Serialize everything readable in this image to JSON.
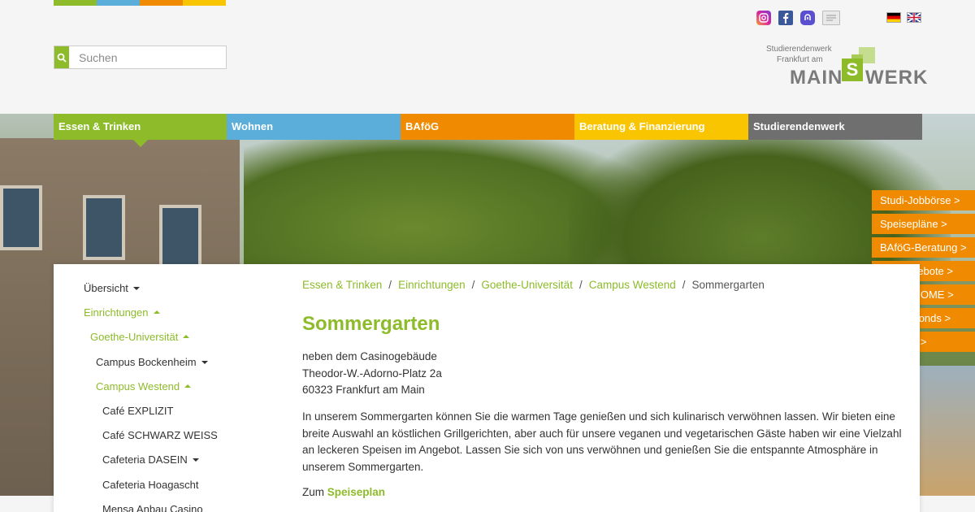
{
  "brand_colors": {
    "green": "#8dbb2a",
    "blue": "#5aaed9",
    "orange": "#f08a00",
    "yellow": "#f9c400",
    "gray": "#6f6f6f"
  },
  "search": {
    "placeholder": "Suchen"
  },
  "social": [
    "instagram-icon",
    "facebook-icon",
    "mastodon-icon",
    "blog-icon"
  ],
  "languages": [
    "german-flag-icon",
    "english-flag-icon"
  ],
  "logo": {
    "line1": "Studierendenwerk",
    "line2": "Frankfurt am",
    "main": "MAIN",
    "s": "S",
    "werk": "WERK"
  },
  "nav": [
    {
      "label": "Essen & Trinken",
      "color": "#8dbb2a",
      "active": true
    },
    {
      "label": "Wohnen",
      "color": "#5aaed9"
    },
    {
      "label": "BAföG",
      "color": "#f08a00"
    },
    {
      "label": "Beratung & Finanzierung",
      "color": "#f9c400"
    },
    {
      "label": "Studierendenwerk",
      "color": "#6f6f6f"
    }
  ],
  "quick_links": [
    "Studi-Jobbörse >",
    "Speisepläne >",
    "BAföG-Beratung >",
    "Mietangebote >",
    "Hostel HOME >",
    "Nothilfefonds >",
    "Karriere >"
  ],
  "sidenav": [
    {
      "label": "Übersicht",
      "caret": "down"
    },
    {
      "label": "Einrichtungen",
      "caret": "up",
      "active": true
    },
    {
      "label": "Goethe-Universität",
      "caret": "up",
      "active": true
    },
    {
      "label": "Campus Bockenheim",
      "caret": "down"
    },
    {
      "label": "Campus Westend",
      "caret": "up",
      "active": true
    },
    {
      "label": "Café EXPLIZIT"
    },
    {
      "label": "Café SCHWARZ WEISS"
    },
    {
      "label": "Cafeteria DASEIN",
      "caret": "down"
    },
    {
      "label": "Cafeteria Hoagascht"
    },
    {
      "label": "Mensa Anbau Casino"
    }
  ],
  "breadcrumb": [
    "Essen & Trinken",
    "Einrichtungen",
    "Goethe-Universität",
    "Campus Westend",
    "Sommergarten"
  ],
  "page": {
    "title": "Sommergarten",
    "address": [
      "neben dem Casinogebäude",
      "Theodor-W.-Adorno-Platz 2a",
      "60323 Frankfurt am Main"
    ],
    "intro": "In unserem Sommergarten können Sie die warmen Tage genießen und sich kulinarisch verwöhnen lassen. Wir bieten eine breite Auswahl an köstlichen Grillgerichten, aber auch für unsere veganen und vegetarischen Gäste haben wir eine Vielzahl an leckeren Speisen im Angebot. Lassen Sie sich von uns verwöhnen und genießen Sie die entspannte Atmosphäre in unserem Sommergarten.",
    "more_prefix": "Zum",
    "more_link": "Speiseplan"
  }
}
